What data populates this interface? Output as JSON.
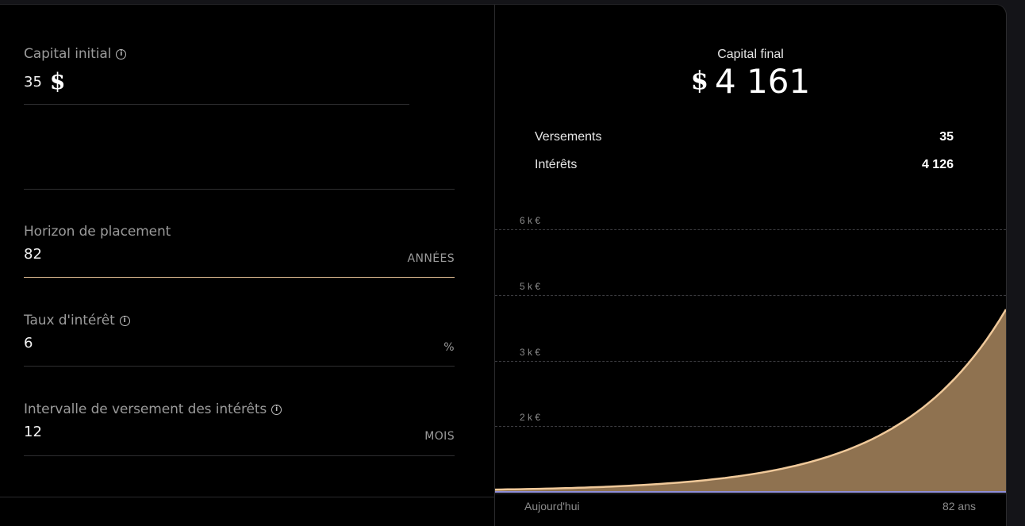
{
  "form": {
    "capital": {
      "label": "Capital initial",
      "value": "35",
      "currency_symbol": "$"
    },
    "horizon": {
      "label": "Horizon de placement",
      "value": "82",
      "unit": "ANNÉES"
    },
    "rate": {
      "label": "Taux d'intérêt",
      "value": "6",
      "unit": "%"
    },
    "interval": {
      "label": "Intervalle de versement des intérêts",
      "value": "12",
      "unit": "MOIS"
    }
  },
  "summary": {
    "final_label": "Capital final",
    "currency_symbol": "$",
    "final_value": "4 161",
    "versements_label": "Versements",
    "versements_value": "35",
    "interets_label": "Intérêts",
    "interets_value": "4 126"
  },
  "chart_data": {
    "type": "area",
    "x_start_label": "Aujourd'hui",
    "x_end_label": "82 ans",
    "yticks": [
      "6 k €",
      "5 k €",
      "3 k €",
      "2 k €"
    ],
    "ytick_values": [
      6000,
      5000,
      3000,
      2000
    ],
    "principal": 35,
    "rate_percent": 6,
    "years": 82,
    "final_value": 4161,
    "colors": {
      "area_fill": "#8f7250",
      "area_line": "#f0c99a",
      "principal_line": "#8f8fd8"
    }
  }
}
